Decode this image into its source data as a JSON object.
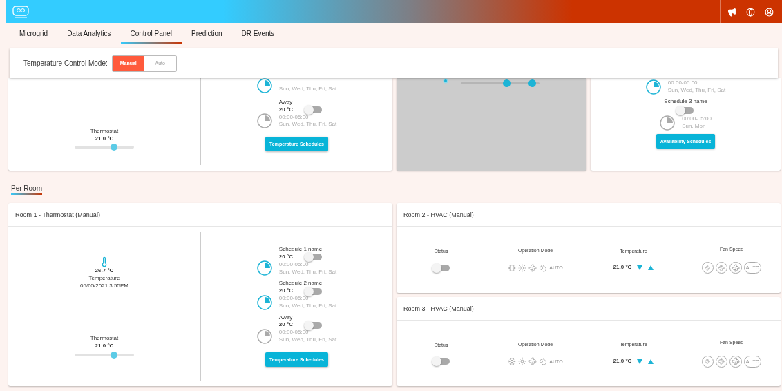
{
  "tabs": [
    {
      "label": "Microgrid",
      "selected": false
    },
    {
      "label": "Data Analytics",
      "selected": false
    },
    {
      "label": "Control Panel",
      "selected": true
    },
    {
      "label": "Prediction",
      "selected": false
    },
    {
      "label": "DR Events",
      "selected": false
    }
  ],
  "mode": {
    "label": "Temperature Control Mode:",
    "options": [
      {
        "label": "Manual",
        "selected": true
      },
      {
        "label": "Auto",
        "selected": false
      }
    ]
  },
  "overview": {
    "thermostat_card": {
      "thermostat": {
        "label": "Thermostat",
        "value": "21.0 °C",
        "level": 0.66
      },
      "schedules": [
        {
          "days": "Sun, Wed, Thu, Fri, Sat",
          "active": true
        },
        {
          "name": "Away",
          "temp": "20 °C",
          "on": false,
          "time": "00:00-05:00",
          "days": "Sun, Wed, Thu, Fri, Sat",
          "active": false
        }
      ],
      "button": "Temperature Schedules"
    },
    "range_card": {
      "handles": [
        {
          "level": 0.58
        },
        {
          "level": 0.9
        }
      ]
    },
    "availability_card": {
      "schedules": [
        {
          "time": "00:00-05:00",
          "days": "Sun, Wed, Thu, Fri, Sat",
          "active": true
        },
        {
          "name": "Schedule 3 name",
          "on": false,
          "time": "00:00-05:00",
          "days": "Sun, Mon",
          "active": false
        }
      ],
      "button": "Availability Schedules"
    }
  },
  "section": {
    "label": "Per Room"
  },
  "rooms": [
    {
      "kind": "thermostat",
      "title": "Room 1 - Thermostat (Manual)",
      "reading": {
        "value": "26.7 °C",
        "label": "Temperature",
        "time": "05/05/2021 3:55PM"
      },
      "thermostat": {
        "label": "Thermostat",
        "value": "21.0 °C",
        "level": 0.66
      },
      "schedules": [
        {
          "name": "Schedule 1 name",
          "temp": "20 °C",
          "on": false,
          "time": "00:00-05:00",
          "days": "Sun, Wed, Thu, Fri, Sat",
          "active": true
        },
        {
          "name": "Schedule 2 name",
          "temp": "20 °C",
          "on": false,
          "time": "00:00-05:00",
          "days": "Sun, Wed, Thu, Fri, Sat",
          "active": true
        },
        {
          "name": "Away",
          "temp": "20 °C",
          "on": false,
          "time": "00:00-05:00",
          "days": "Sun, Wed, Thu, Fri, Sat",
          "active": false
        }
      ],
      "button": "Temperature Schedules"
    },
    {
      "kind": "hvac",
      "title": "Room 2 - HVAC (Manual)",
      "status": {
        "label": "Status",
        "on": false
      },
      "operation": {
        "label": "Operation Mode",
        "auto": "AUTO"
      },
      "temperature": {
        "label": "Temperature",
        "value": "21.0 °C"
      },
      "fan": {
        "label": "Fan Speed",
        "auto": "AUTO"
      }
    },
    {
      "kind": "hvac",
      "title": "Room 3 - HVAC (Manual)",
      "status": {
        "label": "Status",
        "on": false
      },
      "operation": {
        "label": "Operation Mode",
        "auto": "AUTO"
      },
      "temperature": {
        "label": "Temperature",
        "value": "21.0 °C"
      },
      "fan": {
        "label": "Fan Speed",
        "auto": "AUTO"
      }
    }
  ]
}
